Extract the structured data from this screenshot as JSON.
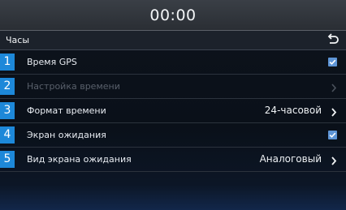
{
  "status": {
    "clock": "00:00"
  },
  "header": {
    "title": "Часы",
    "back_icon": "back-arrow-icon"
  },
  "items": [
    {
      "number": "1",
      "label": "Время GPS",
      "control": "checkbox",
      "checked": true,
      "enabled": true
    },
    {
      "number": "2",
      "label": "Настройка времени",
      "control": "chevron",
      "enabled": false
    },
    {
      "number": "3",
      "label": "Формат времени",
      "value": "24-часовой",
      "control": "chevron",
      "enabled": true
    },
    {
      "number": "4",
      "label": "Экран ожидания",
      "control": "checkbox",
      "checked": true,
      "enabled": true
    },
    {
      "number": "5",
      "label": "Вид экрана ожидания",
      "value": "Аналоговый",
      "control": "chevron",
      "enabled": true
    }
  ],
  "colors": {
    "marker": "#1d88d9",
    "checkbox": "#5e95d6",
    "disabled_text": "#59606b"
  }
}
